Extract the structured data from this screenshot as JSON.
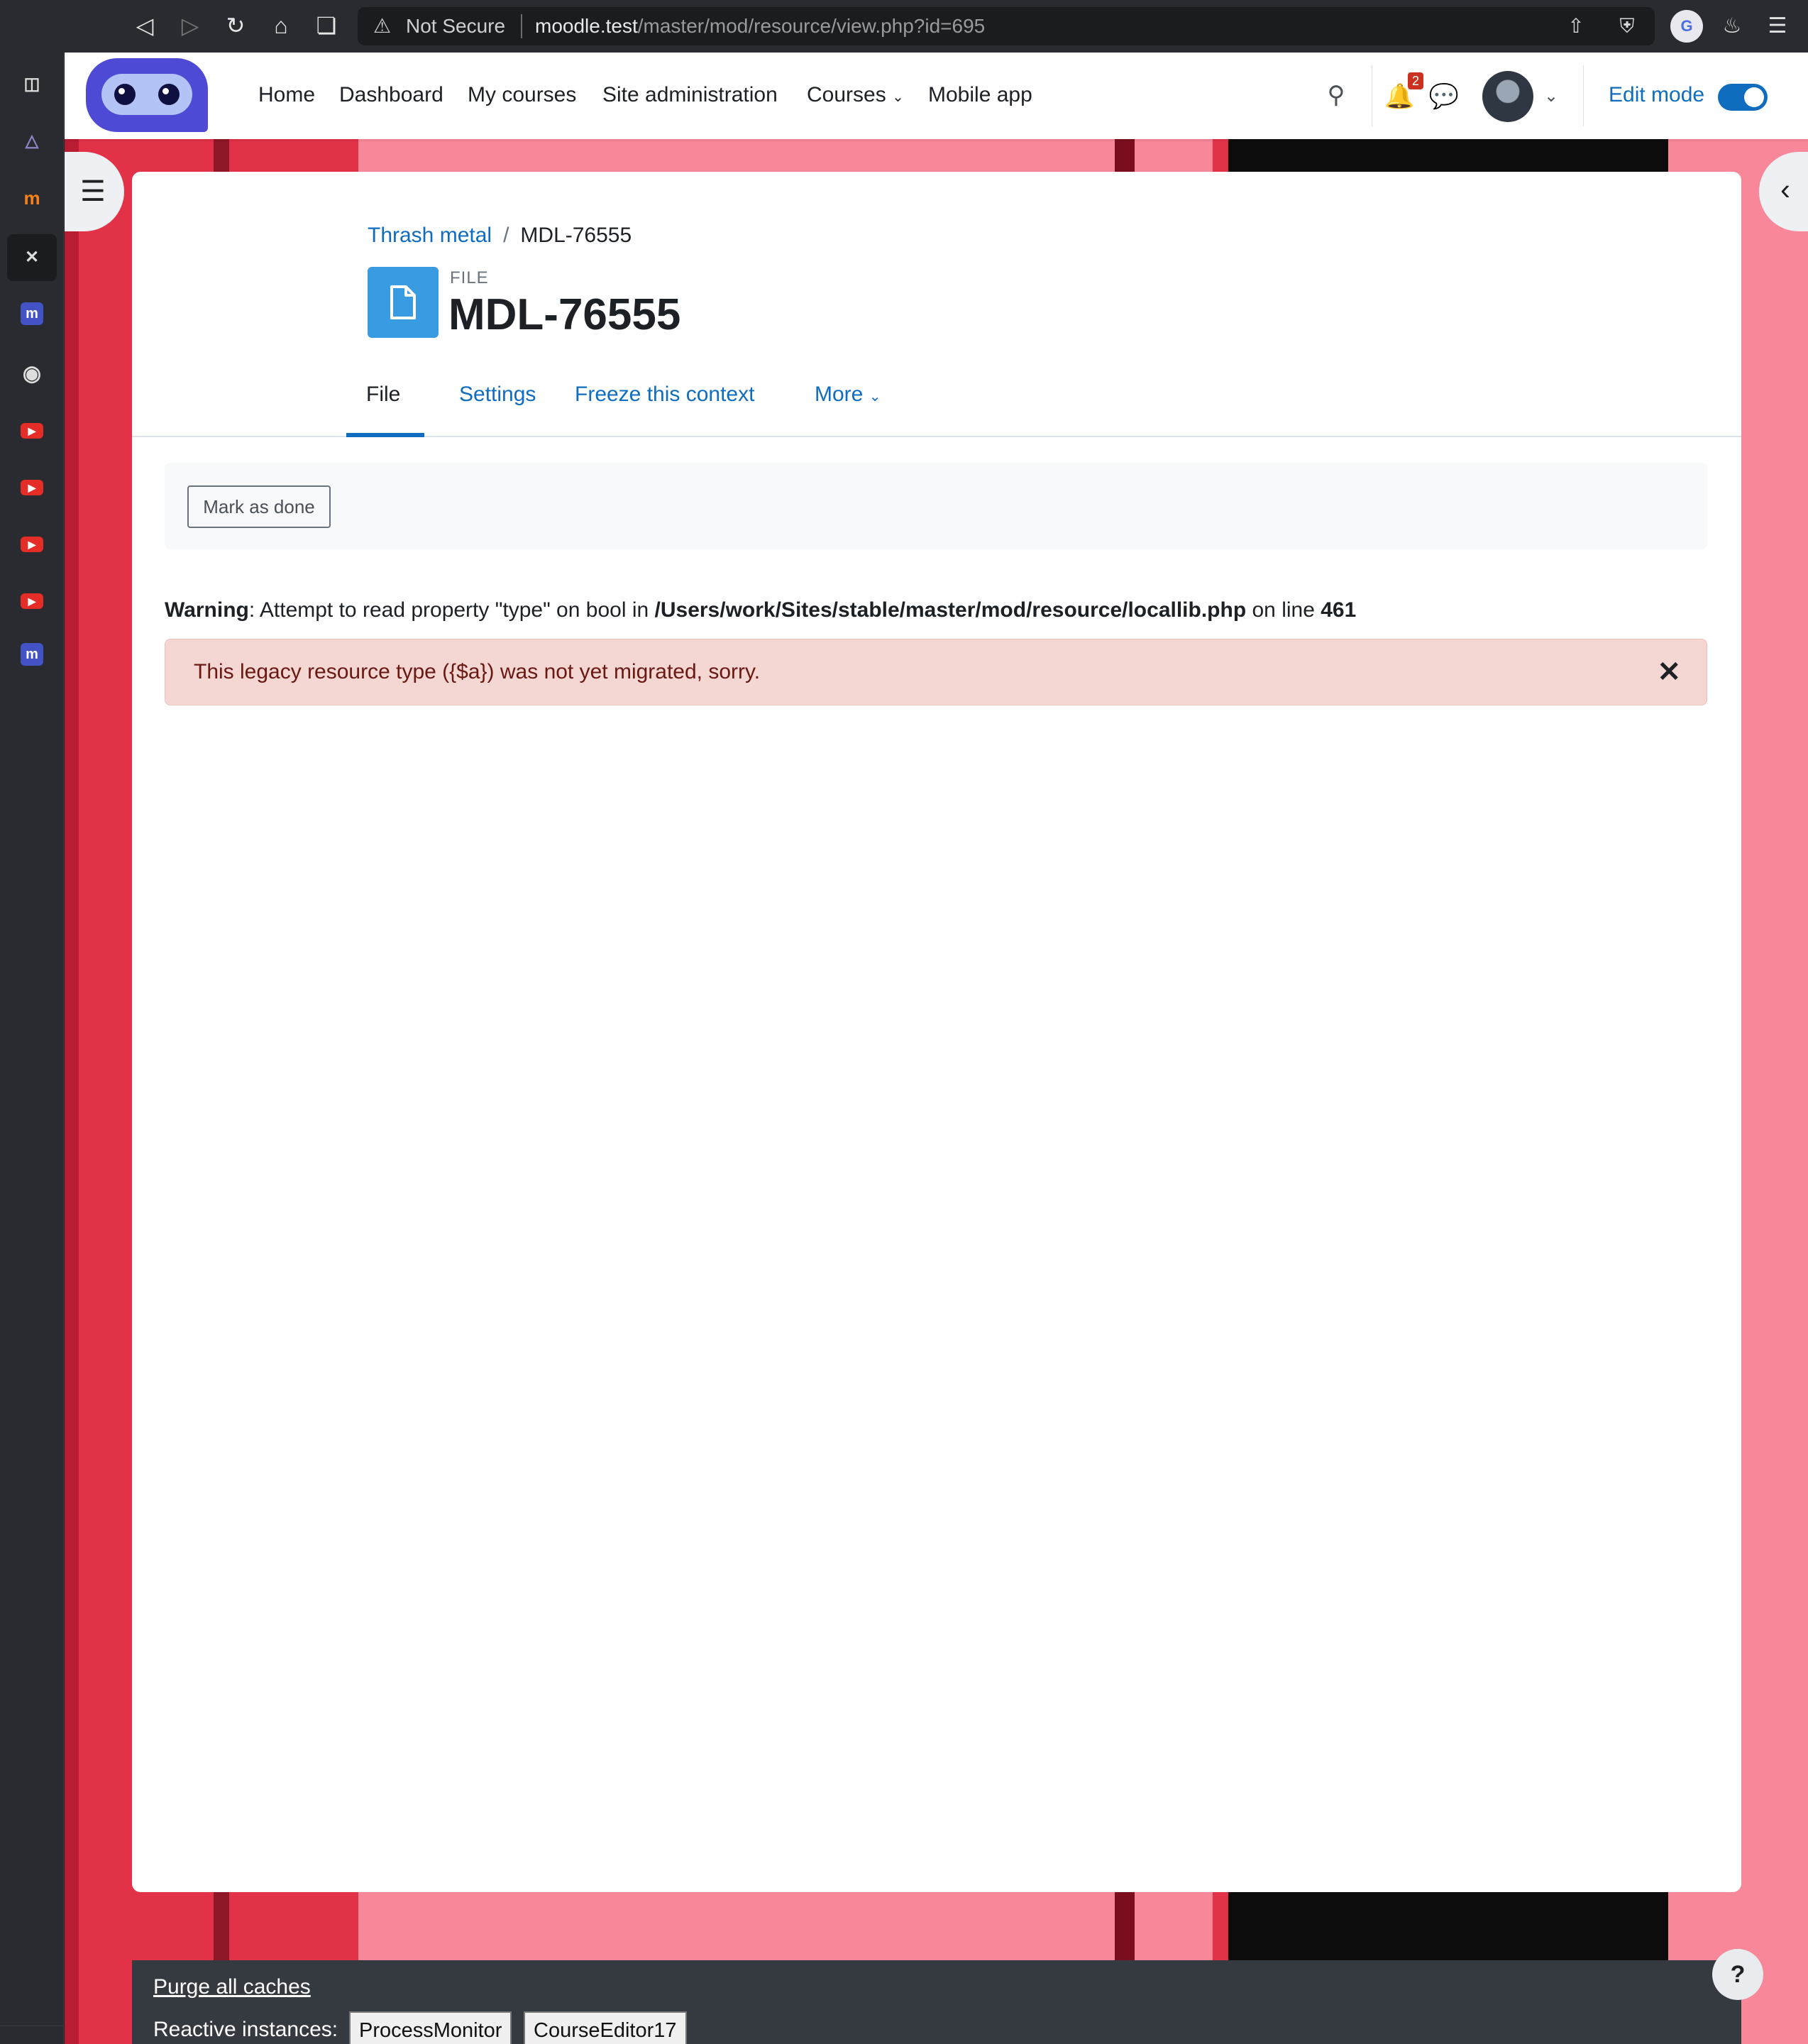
{
  "browser": {
    "back_icon": "back-icon",
    "forward_icon": "forward-icon",
    "reload_icon": "reload-icon",
    "home_icon": "home-icon",
    "bookmark_icon": "bookmark-icon",
    "security_label": "Not Secure",
    "url_host": "moodle.test",
    "url_path": "/master/mod/resource/view.php?id=695"
  },
  "navbar": {
    "links": [
      "Home",
      "Dashboard",
      "My courses",
      "Site administration",
      "Courses",
      "Mobile app"
    ],
    "notification_count": "2",
    "edit_mode_label": "Edit mode",
    "edit_mode_on": true
  },
  "breadcrumb": {
    "course": "Thrash metal",
    "current": "MDL-76555"
  },
  "activity": {
    "purpose": "FILE",
    "title": "MDL-76555"
  },
  "tabs": [
    "File",
    "Settings",
    "Freeze this context",
    "More"
  ],
  "completion": {
    "button_label": "Mark as done"
  },
  "warning": {
    "label": "Warning",
    "text_before": ": Attempt to read property \"type\" on bool in ",
    "path": "/Users/work/Sites/stable/master/mod/resource/locallib.php",
    "text_mid": " on line ",
    "line": "461"
  },
  "alert": {
    "message": "This legacy resource type ({$a}) was not yet migrated, sorry."
  },
  "footer": {
    "purge_label": "Purge all caches",
    "reactive_label": "Reactive instances:",
    "reactive_instances": [
      "ProcessMonitor",
      "CourseEditor17"
    ]
  },
  "help_label": "?",
  "colors": {
    "primary": "#0f6cbf",
    "alert_bg": "#f4d6d2",
    "alert_text": "#691911",
    "background_red": "#e23248",
    "background_pink": "#f78799"
  }
}
